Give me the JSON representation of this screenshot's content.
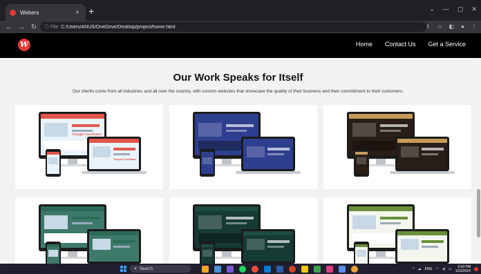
{
  "browser": {
    "tab_title": "Webers",
    "tab_close": "×",
    "new_tab": "+",
    "address_info": "ⓘ File",
    "url": "C:/Users/ANUS/OneDrive/Desktop/project/home.html"
  },
  "site": {
    "logo_text": "W",
    "nav": [
      "Home",
      "Contact Us",
      "Get a Service"
    ]
  },
  "section": {
    "heading": "Our Work Speaks for Itself",
    "subheading": "Our clients come from all industries and all over the country, with custom websites that showcase the quality of their business and their commitment to their customers."
  },
  "portfolio_cards": [
    {
      "theme": "light-blue",
      "accent": "#e2574c",
      "screen_bg": "#eaf3fa",
      "headline": "Triangle Foundation"
    },
    {
      "theme": "navy",
      "accent": "#2f3f8f",
      "screen_bg": "#2f3f8f",
      "headline": ""
    },
    {
      "theme": "dark-construction",
      "accent": "#c89b5a",
      "screen_bg": "#2a1e18",
      "headline": ""
    },
    {
      "theme": "resort-green",
      "accent": "#2e6a5a",
      "screen_bg": "#3d7a6a",
      "headline": ""
    },
    {
      "theme": "dark-forest",
      "accent": "#1f4a40",
      "screen_bg": "#163a34",
      "headline": ""
    },
    {
      "theme": "green-profile",
      "accent": "#6a8f3a",
      "screen_bg": "#f3f6ee",
      "headline": ""
    }
  ],
  "taskbar": {
    "search_label": "Search",
    "language": "ENG",
    "time": "6:50 PM",
    "date": "1/22/2024"
  },
  "colors": {
    "navbar_bg": "#000000",
    "page_bg": "#f2f2f2",
    "brand_red": "#e53935"
  }
}
